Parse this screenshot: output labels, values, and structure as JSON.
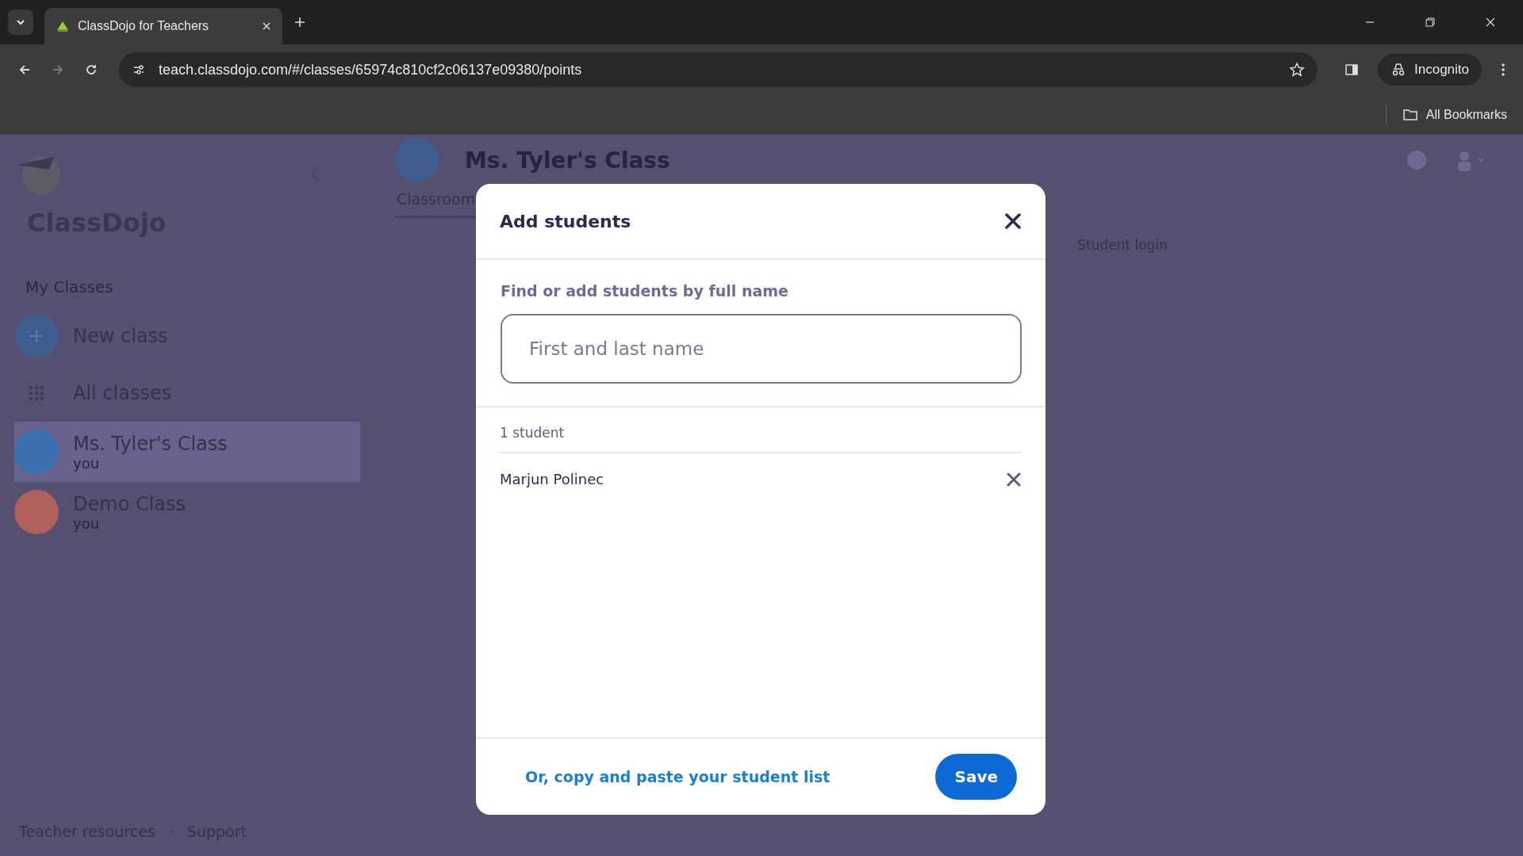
{
  "browser": {
    "tab_title": "ClassDojo for Teachers",
    "url": "teach.classdojo.com/#/classes/65974c810cf2c06137e09380/points",
    "profile": "Incognito",
    "bookmarks": "All Bookmarks"
  },
  "sidebar": {
    "brand": "ClassDojo",
    "section": "My Classes",
    "items": [
      {
        "kind": "new",
        "label": "New class"
      },
      {
        "kind": "all",
        "label": "All classes"
      },
      {
        "kind": "class",
        "label": "Ms. Tyler's Class",
        "sub": "you",
        "selected": true,
        "color": "#3a6fb0"
      },
      {
        "kind": "class",
        "label": "Demo Class",
        "sub": "you",
        "selected": false,
        "color": "#b0605a"
      }
    ],
    "footer": [
      "Teacher resources",
      "Support"
    ]
  },
  "main": {
    "title": "Ms. Tyler's Class",
    "tabs": [
      {
        "label": "Classroom",
        "selected": true
      }
    ],
    "student_login": "Student login"
  },
  "dialog": {
    "title": "Add students",
    "label": "Find or add students by full name",
    "placeholder": "First and last name",
    "count": "1 student",
    "students": [
      "Marjun Polinec"
    ],
    "paste_link": "Or, copy and paste your student list",
    "save": "Save"
  }
}
